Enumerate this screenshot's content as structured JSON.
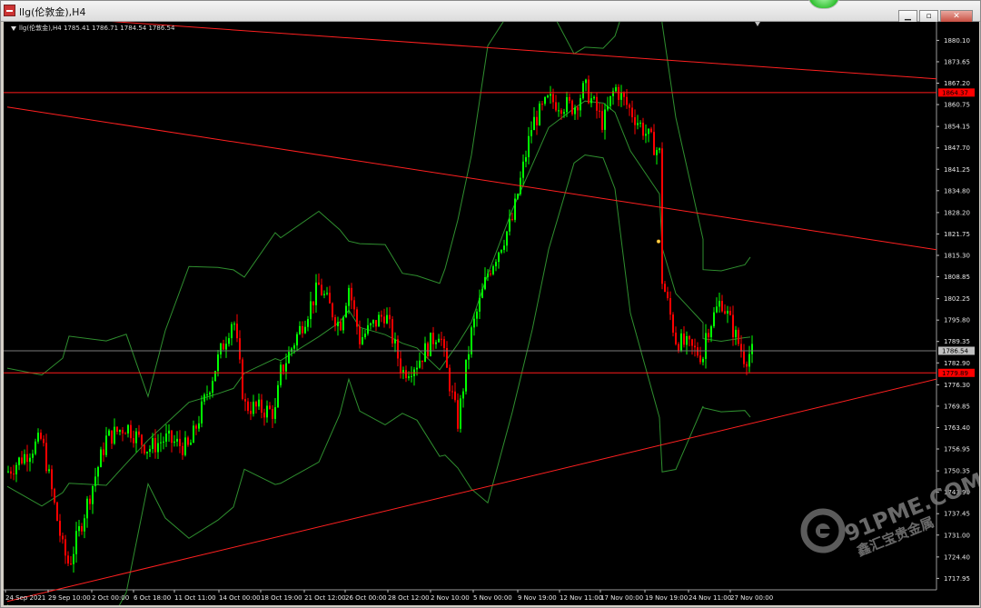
{
  "window": {
    "title": "llg(伦敦金),H4",
    "buttons": [
      {
        "name": "minimize-button",
        "label": "▁"
      },
      {
        "name": "maximize-button",
        "label": "▫"
      },
      {
        "name": "close-button",
        "label": "✕"
      }
    ]
  },
  "chart_info": "llg(伦敦金),H4  1785.41 1786.71 1784.54 1786.54",
  "price_tags": [
    {
      "value": "1864.37",
      "price": 1864.37,
      "color": "#ff0000",
      "text_color": "#000000"
    },
    {
      "value": "1786.54",
      "price": 1786.54,
      "color": "#c0c0c0",
      "text_color": "#000000"
    },
    {
      "value": "1779.89",
      "price": 1779.89,
      "color": "#ff0000",
      "text_color": "#000000"
    }
  ],
  "watermark": {
    "site": "91PME.COM",
    "chinese": "鑫汇宝贵金属",
    "icon": "swirl-logo-icon"
  },
  "chart_data": {
    "type": "candlestick",
    "symbol": "llg(伦敦金)",
    "timeframe": "H4",
    "last_bar": {
      "open": 1785.41,
      "high": 1786.71,
      "low": 1784.54,
      "close": 1786.54
    },
    "y_ticks": [
      1880.1,
      1873.65,
      1867.2,
      1860.75,
      1854.15,
      1847.7,
      1841.25,
      1834.8,
      1828.2,
      1821.75,
      1815.3,
      1808.85,
      1802.25,
      1795.8,
      1789.35,
      1782.9,
      1776.3,
      1769.85,
      1763.4,
      1756.95,
      1750.35,
      1743.9,
      1737.45,
      1731.0,
      1724.4,
      1717.95
    ],
    "ylim": [
      1714.5,
      1883.5
    ],
    "x_ticks": [
      "24 Sep 2021",
      "29 Sep 10:00",
      "2 Oct 00:00",
      "6 Oct 18:00",
      "11 Oct 11:00",
      "14 Oct 00:00",
      "18 Oct 19:00",
      "21 Oct 12:00",
      "26 Oct 00:00",
      "28 Oct 12:00",
      "2 Nov 10:00",
      "5 Nov 00:00",
      "9 Nov 19:00",
      "12 Nov 11:00",
      "17 Nov 00:00",
      "19 Nov 19:00",
      "24 Nov 11:00",
      "27 Nov 00:00"
    ],
    "horizontal_lines": [
      1864.37,
      1786.54,
      1779.89
    ],
    "trend_lines": [
      {
        "start": [
          "24 Sep 2021",
          1888.0
        ],
        "end": [
          "29 Nov",
          1868.5
        ]
      },
      {
        "start": [
          "24 Sep 2021",
          1860.0
        ],
        "end": [
          "29 Nov",
          1817.0
        ]
      },
      {
        "start": [
          "24 Sep 2021",
          1711.0
        ],
        "end": [
          "29 Nov",
          1778.0
        ]
      }
    ],
    "indicator": "Bollinger Bands",
    "up_color": "#00ff00",
    "down_color": "#ff0000",
    "band_color": "#2f8f2f",
    "background": "#000000",
    "price_path": [
      {
        "t": "24 Sep 2021",
        "p": 1750
      },
      {
        "t": "27 Sep",
        "p": 1760
      },
      {
        "t": "29 Sep 10:00",
        "p": 1727
      },
      {
        "t": "30 Sep",
        "p": 1722
      },
      {
        "t": "2 Oct 00:00",
        "p": 1760
      },
      {
        "t": "4 Oct",
        "p": 1764
      },
      {
        "t": "6 Oct 18:00",
        "p": 1757
      },
      {
        "t": "8 Oct",
        "p": 1760
      },
      {
        "t": "11 Oct 11:00",
        "p": 1757
      },
      {
        "t": "13 Oct",
        "p": 1784
      },
      {
        "t": "14 Oct 00:00",
        "p": 1797
      },
      {
        "t": "15 Oct",
        "p": 1770
      },
      {
        "t": "18 Oct 19:00",
        "p": 1768
      },
      {
        "t": "19 Oct",
        "p": 1780
      },
      {
        "t": "21 Oct 12:00",
        "p": 1806
      },
      {
        "t": "22 Oct",
        "p": 1794
      },
      {
        "t": "25 Oct",
        "p": 1806
      },
      {
        "t": "26 Oct 00:00",
        "p": 1790
      },
      {
        "t": "27 Oct",
        "p": 1798
      },
      {
        "t": "28 Oct 12:00",
        "p": 1780
      },
      {
        "t": "29 Oct",
        "p": 1783
      },
      {
        "t": "1 Nov",
        "p": 1793
      },
      {
        "t": "2 Nov 10:00",
        "p": 1783
      },
      {
        "t": "3 Nov",
        "p": 1765
      },
      {
        "t": "4 Nov",
        "p": 1792
      },
      {
        "t": "5 Nov 00:00",
        "p": 1810
      },
      {
        "t": "8 Nov",
        "p": 1826
      },
      {
        "t": "9 Nov 19:00",
        "p": 1855
      },
      {
        "t": "10 Nov",
        "p": 1862
      },
      {
        "t": "12 Nov 11:00",
        "p": 1860
      },
      {
        "t": "15 Nov",
        "p": 1866
      },
      {
        "t": "16 Nov",
        "p": 1855
      },
      {
        "t": "17 Nov 00:00",
        "p": 1866
      },
      {
        "t": "18 Nov",
        "p": 1859
      },
      {
        "t": "19 Nov 19:00",
        "p": 1846
      },
      {
        "t": "22 Nov",
        "p": 1808
      },
      {
        "t": "23 Nov",
        "p": 1790
      },
      {
        "t": "24 Nov 11:00",
        "p": 1785
      },
      {
        "t": "25 Nov",
        "p": 1790
      },
      {
        "t": "26 Nov",
        "p": 1802
      },
      {
        "t": "27 Nov 00:00",
        "p": 1784
      },
      {
        "t": "29 Nov",
        "p": 1786
      }
    ]
  }
}
